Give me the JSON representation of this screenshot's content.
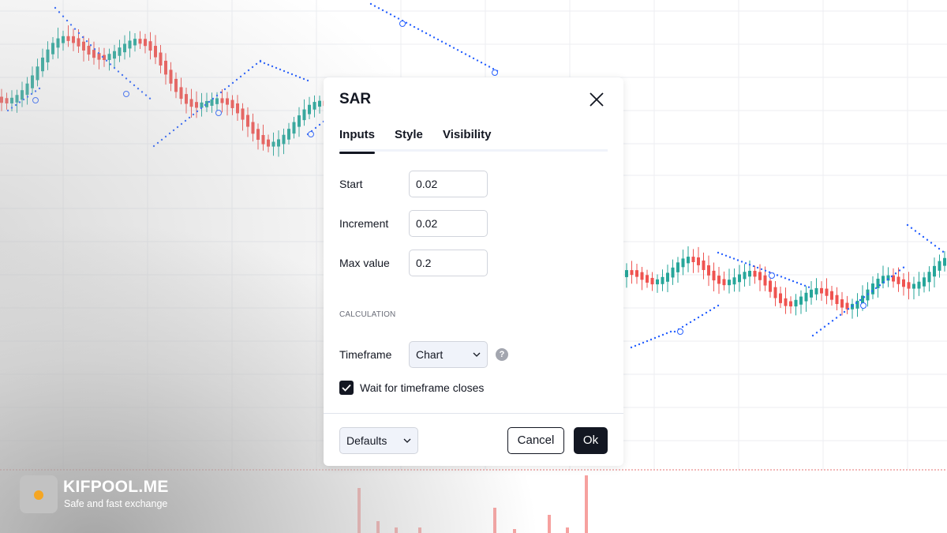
{
  "dialog": {
    "title": "SAR",
    "tabs": [
      "Inputs",
      "Style",
      "Visibility"
    ],
    "active_tab": "Inputs",
    "inputs": [
      {
        "label": "Start",
        "value": "0.02"
      },
      {
        "label": "Increment",
        "value": "0.02"
      },
      {
        "label": "Max value",
        "value": "0.2"
      }
    ],
    "section_calculation": "CALCULATION",
    "timeframe": {
      "label": "Timeframe",
      "value": "Chart",
      "help": "?"
    },
    "wait_checkbox": {
      "label": "Wait for timeframe closes",
      "checked": true
    },
    "footer": {
      "defaults": "Defaults",
      "cancel": "Cancel",
      "ok": "Ok"
    }
  },
  "brand": {
    "name": "KIFPOOL.ME",
    "tagline": "Safe and fast exchange"
  },
  "colors": {
    "bull": "#26a69a",
    "bear": "#ef5350",
    "sar_dots": "#2962ff",
    "dialog_text": "#131722",
    "brand_accent": "#f5a623"
  },
  "icons": {
    "close": "close-icon",
    "chevron": "chevron-down-icon",
    "help": "help-icon",
    "check": "check-icon"
  }
}
